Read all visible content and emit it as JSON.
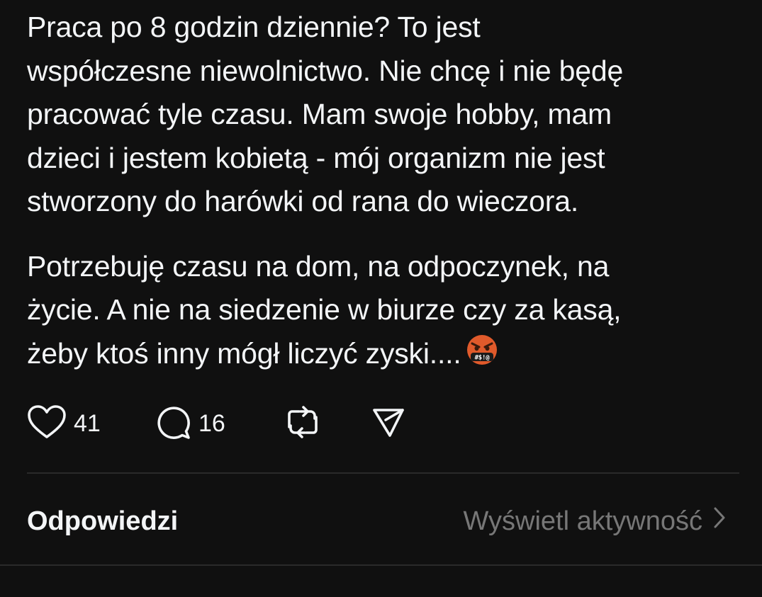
{
  "post": {
    "paragraphs": [
      "Praca po 8 godzin dziennie? To jest\nwspółczesne niewolnictwo. Nie chcę i nie będę\npracować tyle czasu. Mam swoje hobby, mam\ndzieci i jestem kobietą - mój organizm nie jest\nstworzony do harówki od rana do wieczora.",
      "Potrzebuję czasu na dom, na odpoczynek, na\nżycie. A nie na siedzenie w biurze czy za kasą,\nżeby ktoś inny mógł liczyć zyski...."
    ],
    "emoji": "face-with-symbols-on-mouth-icon"
  },
  "actions": {
    "like_icon": "heart-icon",
    "like_count": "41",
    "reply_icon": "speech-bubble-icon",
    "reply_count": "16",
    "repost_icon": "repost-icon",
    "share_icon": "send-icon"
  },
  "replies_section": {
    "title": "Odpowiedzi",
    "activity_link": "Wyświetl aktywność"
  },
  "colors": {
    "background": "#101010",
    "text_primary": "#f3f5f7",
    "text_secondary": "#777777",
    "divider": "#2a2a2a",
    "emoji_face": "#e05a2b"
  }
}
